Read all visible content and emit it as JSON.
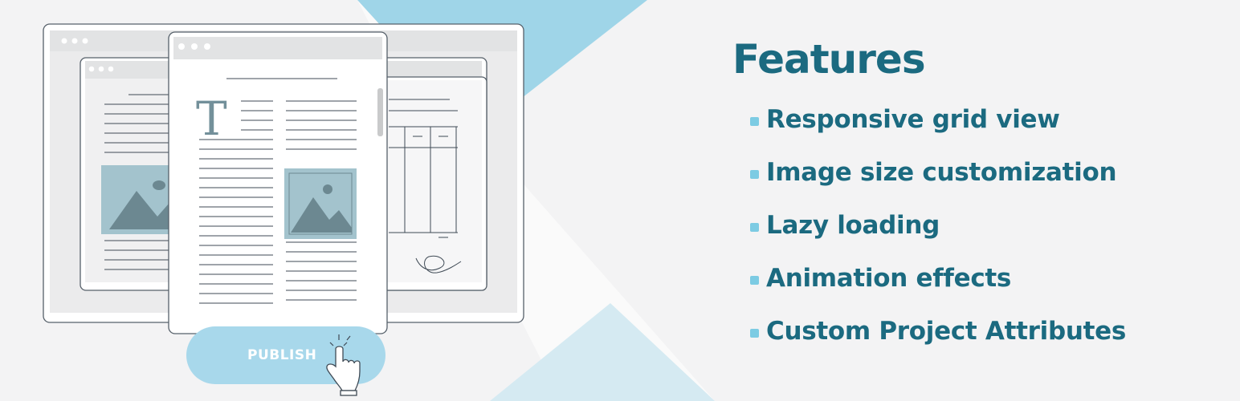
{
  "features": {
    "title": "Features",
    "items": [
      {
        "label": "Responsive grid view"
      },
      {
        "label": "Image size customization"
      },
      {
        "label": "Lazy loading"
      },
      {
        "label": "Animation effects"
      },
      {
        "label": "Custom Project Attributes"
      }
    ]
  },
  "illustration": {
    "publish_label": "PUBLISH",
    "document_letter": "T",
    "icons": [
      "image-placeholder-icon",
      "pointer-hand-icon",
      "signature-icon"
    ]
  },
  "colors": {
    "accent": "#1b6a80",
    "light_blue": "#9fd5e8",
    "pale_blue": "#d5eaf2",
    "background": "#f3f3f4"
  }
}
